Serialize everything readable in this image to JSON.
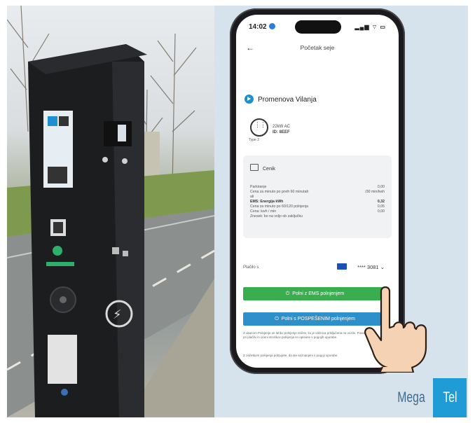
{
  "phone": {
    "time": "14:02",
    "signal": "▂▄▆ ⌔ ▭",
    "title": "Početak sеje",
    "back_icon": "back-arrow-icon"
  },
  "station": {
    "name": "Promenova Vilanja"
  },
  "connector": {
    "type_label": "Type 2",
    "power": "22kW AC",
    "id": "ID: 8EEF"
  },
  "costs": {
    "heading": "Cenik",
    "rows": [
      {
        "label": "Parkiranje",
        "value": "0,00"
      },
      {
        "label": "Cena za minuto po prvih 60 minutah",
        "value": "/30 min/kwh"
      },
      {
        "label": "ali",
        "value": ""
      },
      {
        "label": "EMS: Energija kWh",
        "value": "0,32"
      },
      {
        "label": "Cena za minuto po 60/120 polnjenja",
        "value": "0,05"
      },
      {
        "label": "Cena: kwh / min",
        "value": "0,00"
      },
      {
        "label": "Znesek: bo na voljo ob zaključku",
        "value": ""
      }
    ]
  },
  "payment": {
    "label": "Plačilo s",
    "card_number": "**** 3081",
    "chevron_icon": "chevron-down-icon"
  },
  "buttons": {
    "ems": "Polni z EMS polnjenjem",
    "fast": "Polni s POSPEŠENIM polnjenjem"
  },
  "footnotes": [
    "Z ukazom Polnjenje se lahko polnjenje začne, ko je vtičnica priključena na vozilo. Posebnosti pri plačilu in oceni stroškov polnjenja so opisane v pogojih uporabe.",
    "Z začetkom polnjenja potrjujete, da ste seznanjeni s pogoji uporabe."
  ],
  "logo": {
    "left": "Mega",
    "right": "Tel"
  },
  "colors": {
    "green_button": "#3aad4f",
    "blue_button": "#2f8fc8",
    "panel_bg": "#d6e3ed",
    "logo_blue": "#1f9bd6"
  }
}
